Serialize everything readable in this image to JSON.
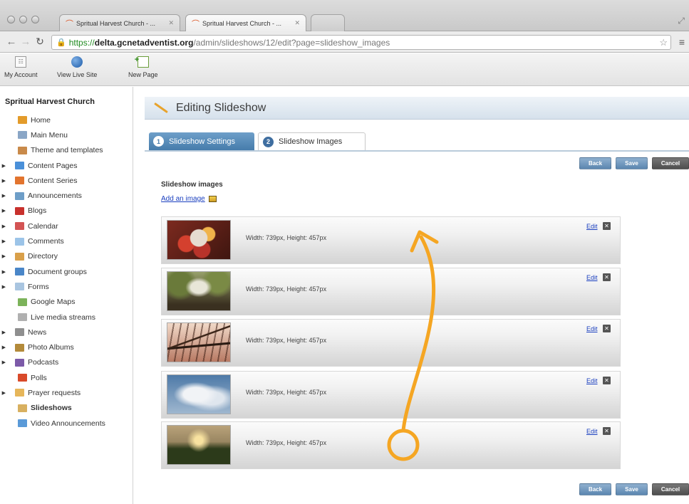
{
  "browser": {
    "tabs": [
      {
        "label": "Spritual Harvest Church - ...",
        "active": false
      },
      {
        "label": "Spritual Harvest Church - ...",
        "active": true
      }
    ],
    "url": {
      "scheme": "https://",
      "host": "delta.gcnetadventist.org",
      "path": "/admin/slideshows/12/edit?page=slideshow_images"
    }
  },
  "toolbar": {
    "items": [
      {
        "label": "My Account",
        "icon": "account-icon"
      },
      {
        "label": "View Live Site",
        "icon": "globe-icon"
      },
      {
        "label": "New Page",
        "icon": "new-page-icon"
      }
    ]
  },
  "sidebar": {
    "site_name": "Spritual Harvest Church",
    "items": [
      {
        "label": "Home",
        "expandable": false,
        "icon_color": "#e39b2a"
      },
      {
        "label": "Main Menu",
        "expandable": false,
        "icon_color": "#8aa6c6"
      },
      {
        "label": "Theme and templates",
        "expandable": false,
        "icon_color": "#c98a4a"
      },
      {
        "label": "Content Pages",
        "expandable": true,
        "icon_color": "#4a90d9"
      },
      {
        "label": "Content Series",
        "expandable": true,
        "icon_color": "#e2742e"
      },
      {
        "label": "Announcements",
        "expandable": true,
        "icon_color": "#6e9ec8"
      },
      {
        "label": "Blogs",
        "expandable": true,
        "icon_color": "#c8312d"
      },
      {
        "label": "Calendar",
        "expandable": true,
        "icon_color": "#d35454"
      },
      {
        "label": "Comments",
        "expandable": true,
        "icon_color": "#9cc4e8"
      },
      {
        "label": "Directory",
        "expandable": true,
        "icon_color": "#d9a04a"
      },
      {
        "label": "Document groups",
        "expandable": true,
        "icon_color": "#4a86c8"
      },
      {
        "label": "Forms",
        "expandable": true,
        "icon_color": "#a9c5e0"
      },
      {
        "label": "Google Maps",
        "expandable": false,
        "icon_color": "#7cb35a"
      },
      {
        "label": "Live media streams",
        "expandable": false,
        "icon_color": "#b0b0b0"
      },
      {
        "label": "News",
        "expandable": true,
        "icon_color": "#8f8f8f"
      },
      {
        "label": "Photo Albums",
        "expandable": true,
        "icon_color": "#b38a3a"
      },
      {
        "label": "Podcasts",
        "expandable": true,
        "icon_color": "#7c5aa8"
      },
      {
        "label": "Polls",
        "expandable": false,
        "icon_color": "#d94a2a"
      },
      {
        "label": "Prayer requests",
        "expandable": true,
        "icon_color": "#e6b65a"
      },
      {
        "label": "Slideshows",
        "expandable": false,
        "icon_color": "#d8b060",
        "current": true
      },
      {
        "label": "Video Announcements",
        "expandable": false,
        "icon_color": "#5a9ad8"
      }
    ]
  },
  "main": {
    "title": "Editing Slideshow",
    "tabs": [
      {
        "num": "1",
        "label": "Slideshow Settings",
        "active": false
      },
      {
        "num": "2",
        "label": "Slideshow Images",
        "active": true
      }
    ],
    "buttons": {
      "back": "Back",
      "save": "Save",
      "cancel": "Cancel"
    },
    "section_label": "Slideshow images",
    "add_link": "Add an image",
    "edit_label": "Edit",
    "images": [
      {
        "dims": "Width: 739px, Height: 457px",
        "thumb": "food-platter"
      },
      {
        "dims": "Width: 739px, Height: 457px",
        "thumb": "garden-path"
      },
      {
        "dims": "Width: 739px, Height: 457px",
        "thumb": "bridge"
      },
      {
        "dims": "Width: 739px, Height: 457px",
        "thumb": "sky-clouds"
      },
      {
        "dims": "Width: 739px, Height: 457px",
        "thumb": "sunset-field"
      }
    ]
  },
  "annotation": {
    "color": "#f5a623",
    "meaning": "drag handle arrow indicating reordering"
  }
}
